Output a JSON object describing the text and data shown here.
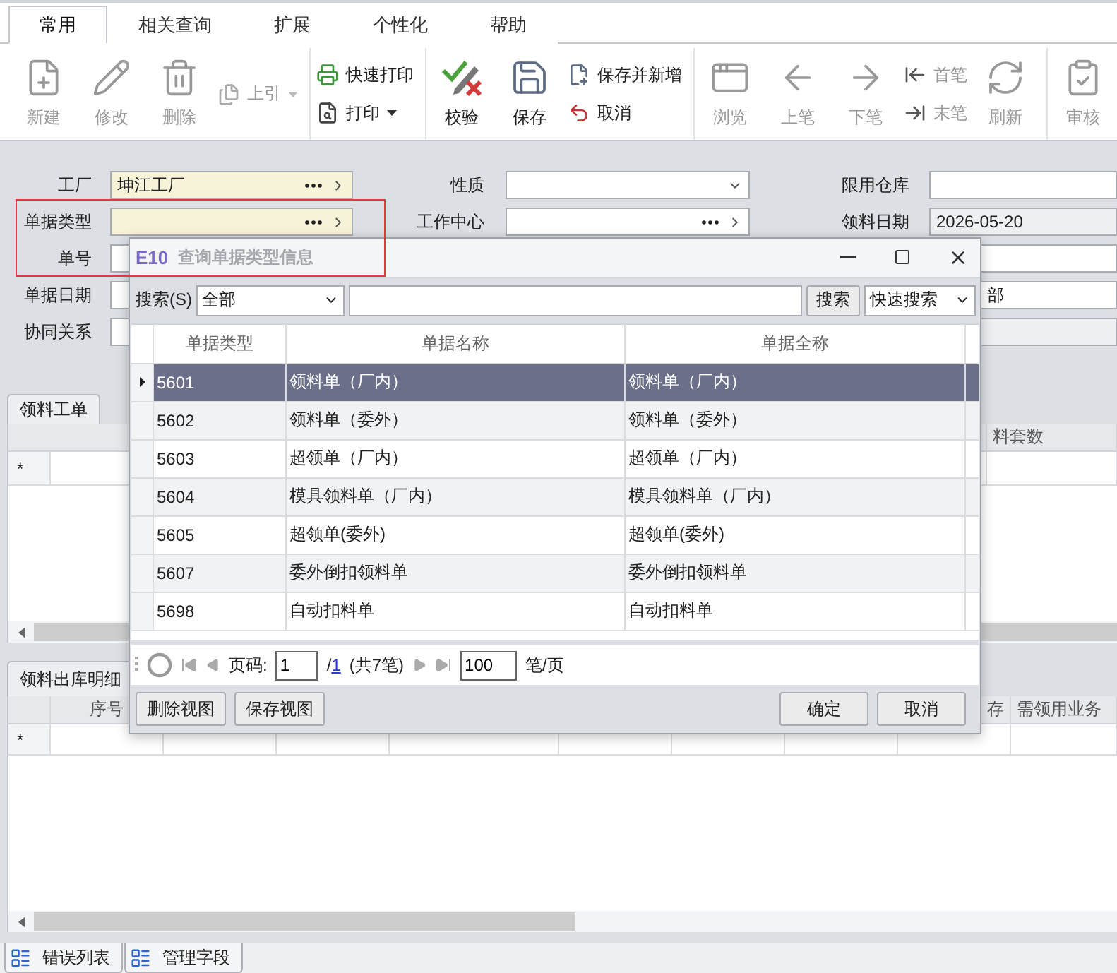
{
  "ribbon_tabs": [
    {
      "label": "常用",
      "selected": true
    },
    {
      "label": "相关查询",
      "selected": false
    },
    {
      "label": "扩展",
      "selected": false
    },
    {
      "label": "个性化",
      "selected": false
    },
    {
      "label": "帮助",
      "selected": false
    }
  ],
  "toolbar": [
    [
      {
        "kind": "large",
        "label": "新建",
        "disabled": true
      },
      {
        "kind": "large",
        "label": "修改",
        "disabled": true
      },
      {
        "kind": "large",
        "label": "删除",
        "disabled": true
      },
      {
        "kind": "stack",
        "items": [
          {
            "label": "上引",
            "disabled": true,
            "dropdown": true
          }
        ]
      }
    ],
    [
      {
        "kind": "stack",
        "items": [
          {
            "label": "快速打印",
            "disabled": false,
            "dropdown": false
          },
          {
            "label": "打印",
            "disabled": false,
            "dropdown": true
          }
        ]
      }
    ],
    [
      {
        "kind": "large",
        "label": "校验",
        "disabled": false
      },
      {
        "kind": "large",
        "label": "保存",
        "disabled": false
      },
      {
        "kind": "stack",
        "items": [
          {
            "label": "保存并新增",
            "disabled": false,
            "dropdown": false
          },
          {
            "label": "取消",
            "disabled": false,
            "dropdown": false
          }
        ]
      }
    ],
    [
      {
        "kind": "large",
        "label": "浏览",
        "disabled": true
      },
      {
        "kind": "large",
        "label": "上笔",
        "disabled": true
      },
      {
        "kind": "large",
        "label": "下笔",
        "disabled": true
      },
      {
        "kind": "stack",
        "items": [
          {
            "label": "首笔",
            "disabled": true,
            "dropdown": false
          },
          {
            "label": "末笔",
            "disabled": true,
            "dropdown": false
          }
        ]
      },
      {
        "kind": "large",
        "label": "刷新",
        "disabled": true
      }
    ],
    [
      {
        "kind": "large",
        "label": "审核",
        "disabled": true
      }
    ]
  ],
  "form": {
    "columns": [
      [
        {
          "label": "工厂",
          "kind": "lookup",
          "value": "坤江工厂",
          "required": true
        },
        {
          "label": "单据类型",
          "kind": "lookup",
          "required": true
        },
        {
          "label": "单号",
          "kind": "text",
          "required": false
        },
        {
          "label": "单据日期",
          "kind": "text",
          "required": false
        },
        {
          "label": "协同关系",
          "kind": "text",
          "required": false
        }
      ],
      [
        {
          "label": "性质",
          "kind": "select",
          "required": false
        },
        {
          "label": "工作中心",
          "kind": "lookup",
          "required": false
        }
      ],
      [
        {
          "label": "限用仓库",
          "kind": "text",
          "required": false
        },
        {
          "label": "领料日期",
          "kind": "readonly",
          "value": "2026-05-20",
          "required": false
        },
        {
          "kind": "text",
          "required": false
        },
        {
          "kind": "text",
          "value": "部",
          "required": false
        },
        {
          "kind": "readonly",
          "required": false
        }
      ]
    ]
  },
  "upper_tabs": [
    {
      "label": "领料工单",
      "selected": true
    }
  ],
  "upper_grid": {
    "new_row_mark": "*",
    "columns": [
      "料套数"
    ]
  },
  "lower_tabs": [
    {
      "label": "领料出库明细",
      "selected": true
    }
  ],
  "lower_grid": {
    "new_row_mark": "*",
    "columns": [
      "序号",
      "存",
      "需领用业务"
    ]
  },
  "bottom_tabs": [
    {
      "label": "错误列表"
    },
    {
      "label": "管理字段"
    }
  ],
  "dialog": {
    "logo": "E10",
    "title": "查询单据类型信息",
    "search_label": "搜索(S)",
    "scope": "全部",
    "search_button": "搜索",
    "search_mode": "快速搜索",
    "columns": [
      "单据类型",
      "单据名称",
      "单据全称"
    ],
    "rows": [
      {
        "cells": [
          "5601",
          "领料单（厂内）",
          "领料单（厂内）"
        ],
        "selected": true
      },
      {
        "cells": [
          "5602",
          "领料单（委外）",
          "领料单（委外）"
        ],
        "selected": false
      },
      {
        "cells": [
          "5603",
          "超领单（厂内）",
          "超领单（厂内）"
        ],
        "selected": false
      },
      {
        "cells": [
          "5604",
          "模具领料单（厂内）",
          "模具领料单（厂内）"
        ],
        "selected": false
      },
      {
        "cells": [
          "5605",
          "超领单(委外)",
          "超领单(委外)"
        ],
        "selected": false
      },
      {
        "cells": [
          "5607",
          "委外倒扣领料单",
          "委外倒扣领料单"
        ],
        "selected": false
      },
      {
        "cells": [
          "5698",
          "自动扣料单",
          "自动扣料单"
        ],
        "selected": false
      }
    ],
    "pager": {
      "page_label": "页码:",
      "page": "1",
      "total_prefix": "/",
      "total_pages": "1",
      "count": "(共7笔)",
      "page_size": "100",
      "unit": "笔/页"
    },
    "left_buttons": [
      "删除视图",
      "保存视图"
    ],
    "right_buttons": [
      "确定",
      "取消"
    ]
  }
}
